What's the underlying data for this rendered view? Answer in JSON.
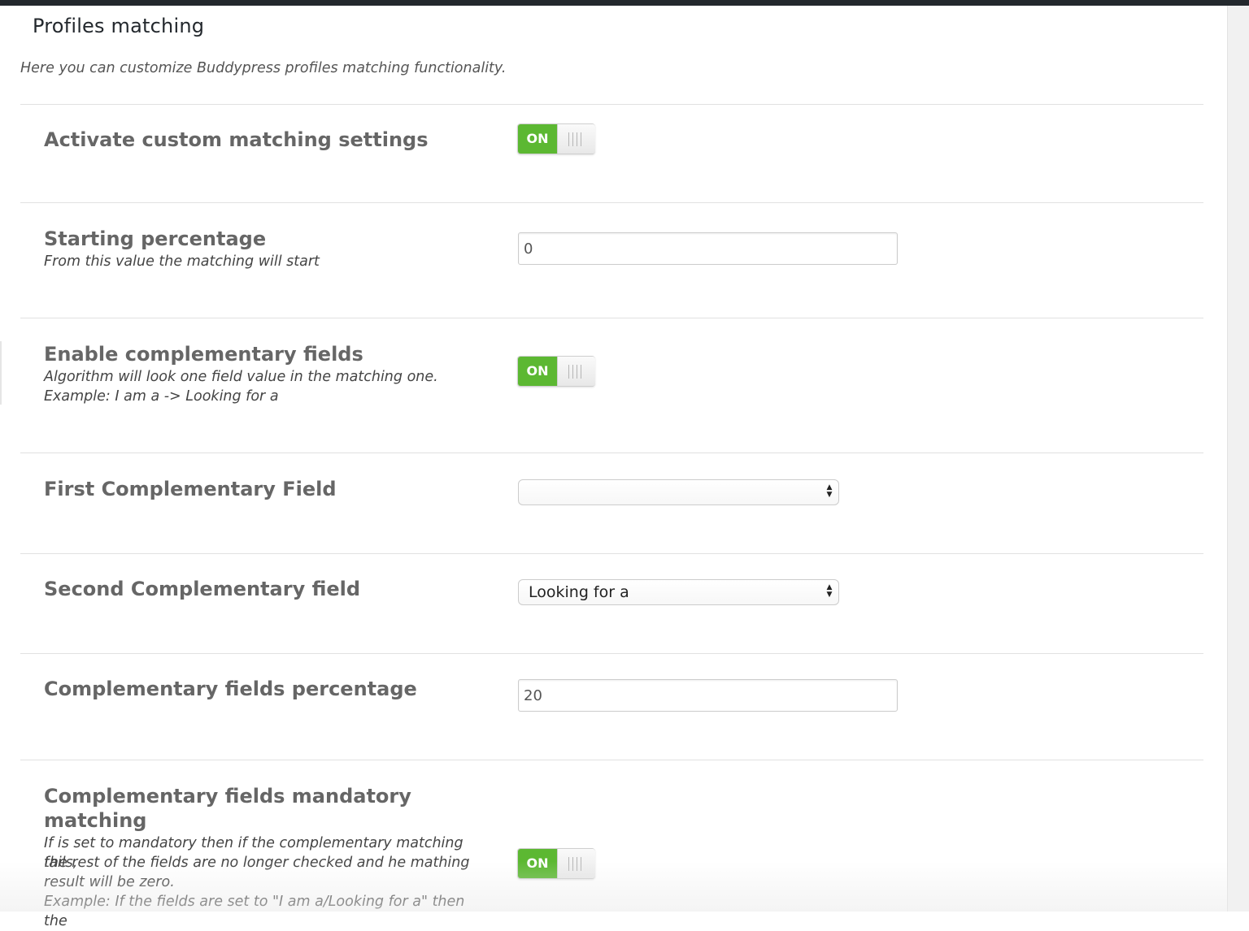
{
  "panel": {
    "title": "Profiles matching",
    "description": "Here you can customize Buddypress profiles matching functionality."
  },
  "settings": {
    "activate_custom": {
      "title": "Activate custom matching settings",
      "toggle_label": "ON"
    },
    "starting_percentage": {
      "title": "Starting percentage",
      "description": "From this value the matching will start",
      "value": "0"
    },
    "enable_complementary": {
      "title": "Enable complementary fields",
      "description_line1": "Algorithm will look one field value in the matching one.",
      "description_line2": "Example: I am a -> Looking for a",
      "toggle_label": "ON"
    },
    "first_complementary": {
      "title": "First Complementary Field",
      "selected": ""
    },
    "second_complementary": {
      "title": "Second Complementary field",
      "selected": "Looking for a"
    },
    "complementary_percentage": {
      "title": "Complementary fields percentage",
      "value": "20"
    },
    "mandatory_matching": {
      "title": "Complementary fields mandatory matching",
      "description_line1": "If is set to mandatory then if the complementary matching fails,",
      "description_line2": "the rest of the fields are no longer checked and he mathing",
      "description_line3": "result will be zero.",
      "description_line4": "Example: If the fields are set to \"I am a/Looking for a\" then the",
      "toggle_label": "ON"
    }
  },
  "icons": {
    "select_arrows": "up-down-chevron-icon",
    "toggle_grip": "grip-lines-icon"
  },
  "colors": {
    "toggle_on": "#5cb832",
    "topbar": "#23282d",
    "heading": "#666666"
  }
}
